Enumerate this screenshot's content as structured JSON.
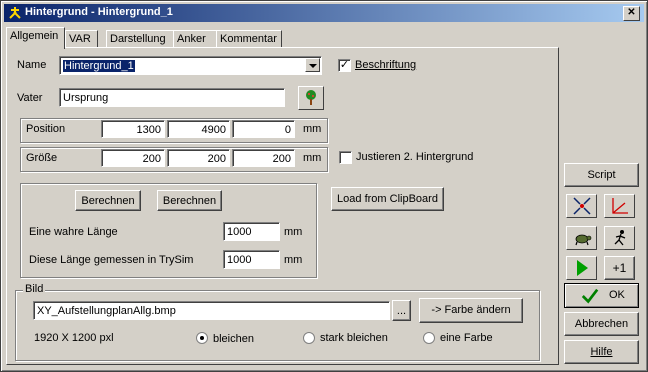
{
  "window": {
    "title": "Hintergrund - Hintergrund_1"
  },
  "icons": {
    "title": "sun-anchor-icon",
    "close": "close-icon",
    "tree": "tree-icon",
    "dropdown": "chevron-down-icon"
  },
  "tabs": [
    {
      "label": "Allgemein",
      "active": true
    },
    {
      "label": "VAR",
      "active": false
    },
    {
      "label": "Darstellung",
      "active": false
    },
    {
      "label": "Anker",
      "active": false
    },
    {
      "label": "Kommentar",
      "active": false
    }
  ],
  "general": {
    "name_label": "Name",
    "name_value": "Hintergrund_1",
    "beschriftung_label": "Beschriftung",
    "beschriftung_checked": true,
    "vater_label": "Vater",
    "vater_value": "Ursprung"
  },
  "position": {
    "label": "Position",
    "values": [
      "1300",
      "4900",
      "0"
    ],
    "unit": "mm"
  },
  "groesse": {
    "label": "Größe",
    "values": [
      "200",
      "200",
      "200"
    ],
    "unit": "mm"
  },
  "justieren": {
    "label": "Justieren 2. Hintergrund",
    "checked": false
  },
  "calc": {
    "button1": "Berechnen",
    "button2": "Berechnen",
    "true_length_label": "Eine wahre Länge",
    "true_length_value": "1000",
    "true_length_unit": "mm",
    "measured_label": "Diese Länge gemessen in TrySim",
    "measured_value": "1000",
    "measured_unit": "mm"
  },
  "clipboard_button": "Load from ClipBoard",
  "bild": {
    "title": "Bild",
    "file": "XY_AufstellungplanAllg.bmp",
    "browse": "...",
    "color_button": "-> Farbe ändern",
    "dimensions": "1920 X 1200 pxl",
    "options": [
      {
        "label": "bleichen",
        "selected": true
      },
      {
        "label": "stark bleichen",
        "selected": false
      },
      {
        "label": "eine Farbe",
        "selected": false
      }
    ]
  },
  "side": {
    "script": "Script",
    "plus_one": "+1",
    "ok": "OK",
    "cancel": "Abbrechen",
    "help": "Hilfe"
  },
  "colors": {
    "accent": "#0a246a",
    "face": "#d4d0c8",
    "play": "#00a000",
    "axes": "#d00000",
    "ok_check": "#008000"
  }
}
